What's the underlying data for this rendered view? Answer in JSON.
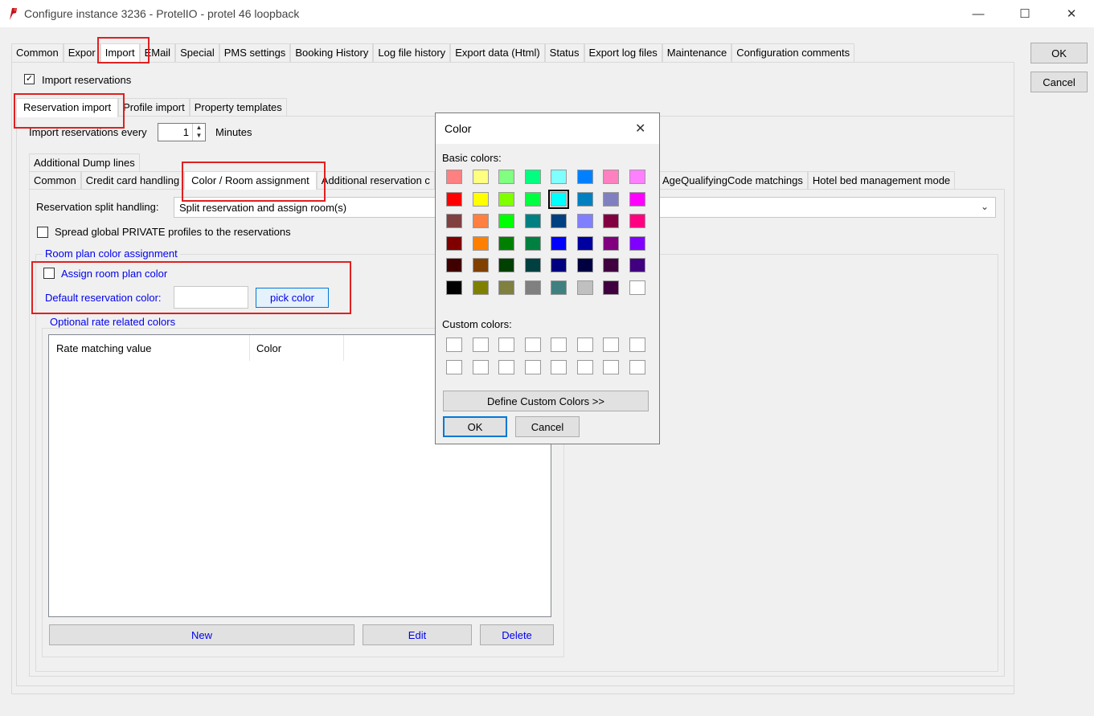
{
  "window": {
    "title": "Configure instance 3236 - ProtelIO - protel 46 loopback"
  },
  "main_tabs": [
    "Common",
    "Expor",
    "Import",
    "EMail",
    "Special",
    "PMS settings",
    "Booking History",
    "Log file history",
    "Export data (Html)",
    "Status",
    "Export log files",
    "Maintenance",
    "Configuration comments"
  ],
  "side_buttons": {
    "ok": "OK",
    "cancel": "Cancel"
  },
  "import_reservations": {
    "label": "Import reservations",
    "checked": true
  },
  "sub_tabs": [
    "Reservation import",
    "Profile import",
    "Property templates"
  ],
  "interval": {
    "label": "Import reservations every",
    "value": "1",
    "unit": "Minutes"
  },
  "tab_dump": "Additional Dump lines",
  "inner_tabs": [
    "Common",
    "Credit card handling",
    "Color / Room assignment",
    "Additional reservation c",
    "AgeQualifyingCode matchings",
    "Hotel bed management mode"
  ],
  "split": {
    "label": "Reservation split handling:",
    "value": "Split reservation and assign room(s)"
  },
  "spread": {
    "label": "Spread global PRIVATE profiles to the reservations",
    "checked": false
  },
  "room_plan": {
    "group_label": "Room plan color assignment",
    "assign_label": "Assign room plan color",
    "assign_checked": false,
    "default_label": "Default reservation color:",
    "default_value": "",
    "pick_label": "pick color"
  },
  "rate_colors": {
    "group_label": "Optional rate related colors",
    "columns": [
      "Rate matching value",
      "Color"
    ],
    "new_label": "New",
    "edit_label": "Edit",
    "delete_label": "Delete"
  },
  "color_dialog": {
    "title": "Color",
    "basic_label": "Basic colors:",
    "basic_colors": [
      "#ff8080",
      "#ffff80",
      "#80ff80",
      "#00ff80",
      "#80ffff",
      "#0080ff",
      "#ff80c0",
      "#ff80ff",
      "#ff0000",
      "#ffff00",
      "#80ff00",
      "#00ff40",
      "#00ffff",
      "#0080c0",
      "#8080c0",
      "#ff00ff",
      "#804040",
      "#ff8040",
      "#00ff00",
      "#008080",
      "#004080",
      "#8080ff",
      "#800040",
      "#ff0080",
      "#800000",
      "#ff8000",
      "#008000",
      "#008040",
      "#0000ff",
      "#0000a0",
      "#800080",
      "#8000ff",
      "#400000",
      "#804000",
      "#004000",
      "#004040",
      "#000080",
      "#000040",
      "#400040",
      "#400080",
      "#000000",
      "#808000",
      "#808040",
      "#808080",
      "#408080",
      "#c0c0c0",
      "#400040",
      "#ffffff"
    ],
    "selected_index": 12,
    "custom_label": "Custom colors:",
    "define_label": "Define Custom Colors >>",
    "ok_label": "OK",
    "cancel_label": "Cancel"
  }
}
